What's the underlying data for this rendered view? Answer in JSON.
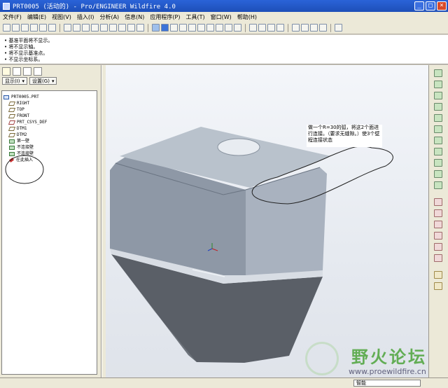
{
  "window": {
    "title": "PRT0005 (活动的) - Pro/ENGINEER Wildfire 4.0",
    "controls": [
      "_",
      "□",
      "×"
    ]
  },
  "menubar": {
    "items": [
      "文件(F)",
      "编辑(E)",
      "视图(V)",
      "插入(I)",
      "分析(A)",
      "信息(N)",
      "应用程序(P)",
      "工具(T)",
      "窗口(W)",
      "帮助(H)"
    ]
  },
  "messages": [
    "• 基准平面将不显示。",
    "• 将不显示轴。",
    "• 将不显示基准点。",
    "• 不显示坐标系。"
  ],
  "left_panel": {
    "show_dropdown": "显示(I)",
    "settings_dropdown": "设置(G)",
    "tree": [
      {
        "label": "PRT0005.PRT",
        "kind": "part"
      },
      {
        "label": "RIGHT",
        "kind": "plane"
      },
      {
        "label": "TOP",
        "kind": "plane"
      },
      {
        "label": "FRONT",
        "kind": "plane"
      },
      {
        "label": "PRT_CSYS_DEF",
        "kind": "csys"
      },
      {
        "label": "DTM1",
        "kind": "plane"
      },
      {
        "label": "DTM2",
        "kind": "plane"
      },
      {
        "label": "第一壁",
        "kind": "feat"
      },
      {
        "label": "不连接壁",
        "kind": "feat"
      },
      {
        "label": "不连接壁",
        "kind": "feat"
      },
      {
        "label": "在此插入",
        "kind": "insert"
      }
    ]
  },
  "annotation": {
    "text": "做一个R=30的弧，将这2个面进行连接。（要求无缝隙。）使3个壁程连接状态"
  },
  "statusbar": {
    "filter_value": "智能"
  },
  "watermark": {
    "main": "野火论坛",
    "url": "www.proewildfire.cn"
  },
  "colors": {
    "title_bar": "#2458c8",
    "viewport_bg": "#eef0f4",
    "model_upper": "#8f9aa8",
    "model_lower": "#555a62",
    "sketch_ink": "#222222"
  }
}
